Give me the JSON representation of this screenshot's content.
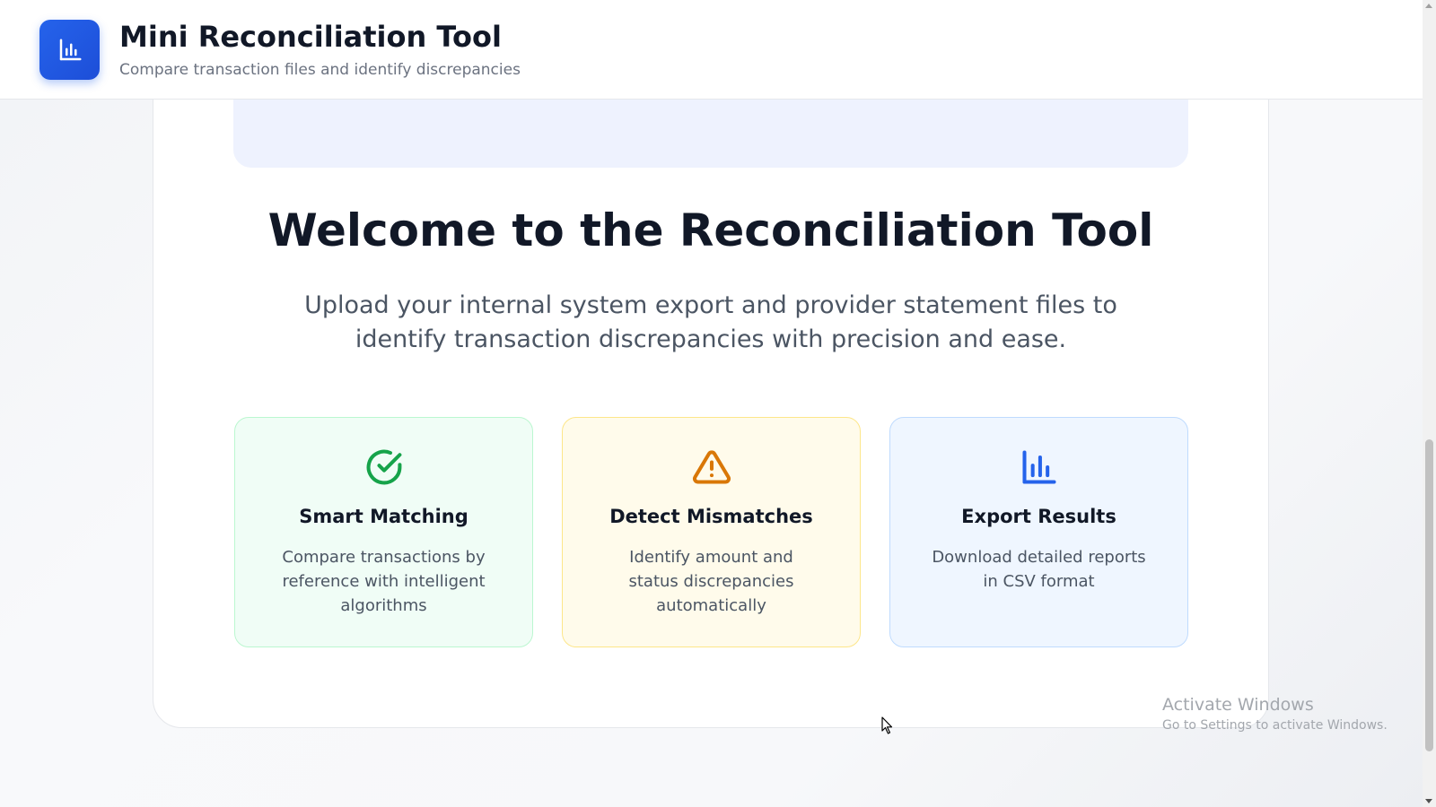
{
  "header": {
    "title": "Mini Reconciliation Tool",
    "subtitle": "Compare transaction files and identify discrepancies",
    "logo_icon": "bar-chart-icon"
  },
  "welcome": {
    "title": "Welcome to the Reconciliation Tool",
    "description": "Upload your internal system export and provider statement files to identify transaction discrepancies with precision and ease."
  },
  "features": [
    {
      "icon": "check-circle-icon",
      "title": "Smart Matching",
      "description": "Compare transactions by reference with intelligent algorithms",
      "accent": "#16a34a"
    },
    {
      "icon": "warning-triangle-icon",
      "title": "Detect Mismatches",
      "description": "Identify amount and status discrepancies automatically",
      "accent": "#d97706"
    },
    {
      "icon": "bar-chart-icon",
      "title": "Export Results",
      "description": "Download detailed reports in CSV format",
      "accent": "#2563eb"
    }
  ],
  "watermark": {
    "title": "Activate Windows",
    "subtitle": "Go to Settings to activate Windows."
  },
  "colors": {
    "primary": "#2563eb",
    "heading": "#111827",
    "muted": "#6b7280"
  }
}
